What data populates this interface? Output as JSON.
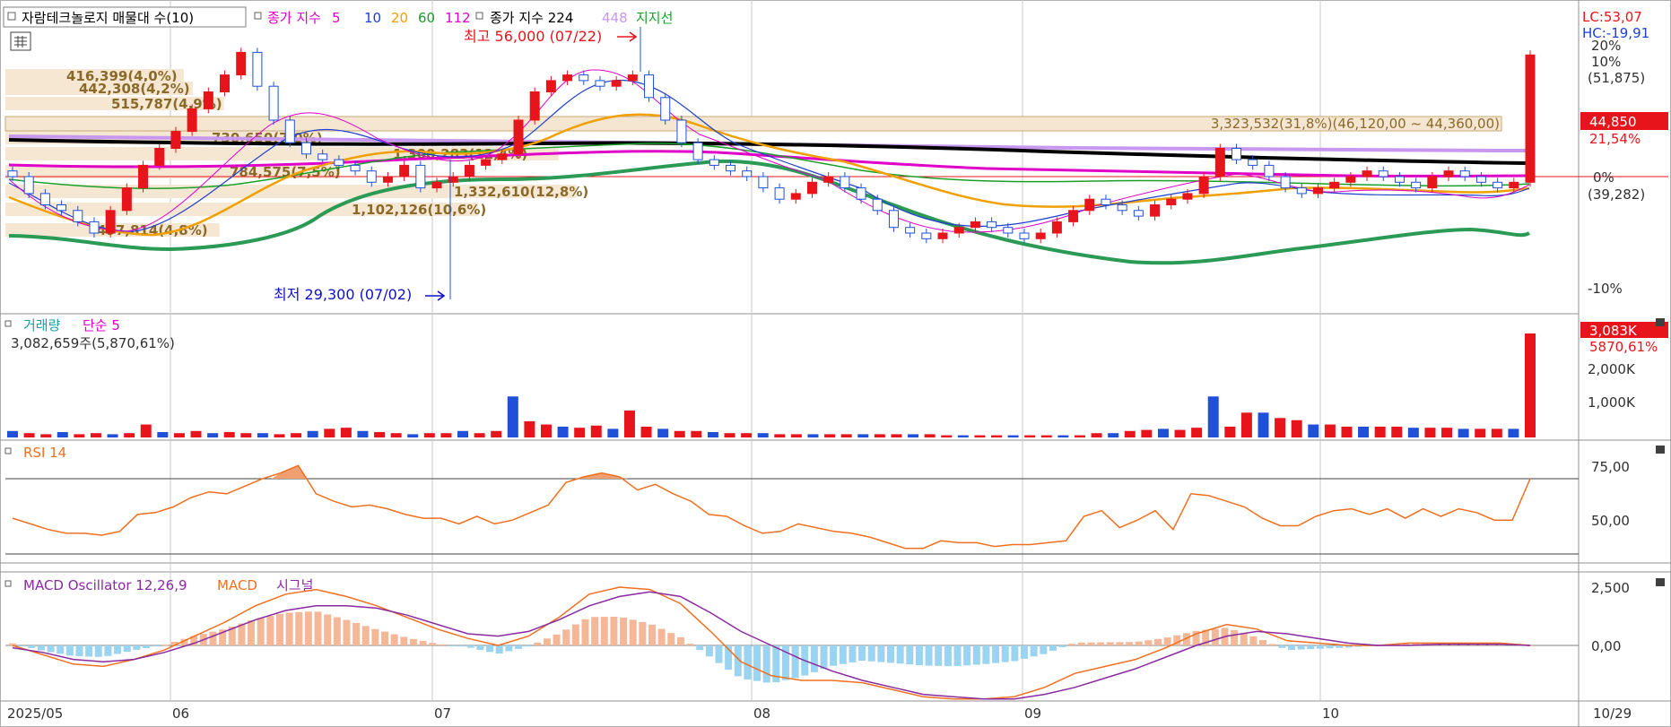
{
  "main_legend": {
    "title": "자람테크놀로지 매물대 수(10)",
    "ma_label": "종가 지수",
    "ma_periods": [
      "5",
      "10",
      "20",
      "60",
      "112"
    ],
    "ma_colors": [
      "#e000c8",
      "#1f3fd0",
      "#f0a000",
      "#1aa02a",
      "#e000c8"
    ],
    "long_label": "종가 지수 224",
    "long_2": "448",
    "support": "지지선"
  },
  "indicators": {
    "lc": "LC:53,07",
    "hc": "HC:-19,91",
    "high": "최고 56,000 (07/22)",
    "low": "최저 29,300 (07/02)",
    "range_label": "3,323,532(31,8%)(46,120,00 ~ 44,360,00)"
  },
  "right_axis": {
    "p20": "20%",
    "p10": "10%",
    "price_hi": "(51,875)",
    "price_tag": "44,850",
    "pct_tag": "21,54%",
    "zero": "0%",
    "price_lo": "(39,282)",
    "m10": "-10%"
  },
  "volume_profile": [
    {
      "label": "416,399(4,0%)",
      "value": 416399,
      "pct": 4.0
    },
    {
      "label": "442,308(4,2%)",
      "value": 442308,
      "pct": 4.2
    },
    {
      "label": "515,787(4,9%)",
      "value": 515787,
      "pct": 4.9
    },
    {
      "label": "730,650(7,0%)",
      "value": 730650,
      "pct": 7.0
    },
    {
      "label": "1,300,283(12,4%)",
      "value": 1300283,
      "pct": 12.4
    },
    {
      "label": "784,575(7,5%)",
      "value": 784575,
      "pct": 7.5
    },
    {
      "label": "1,332,610(12,8%)",
      "value": 1332610,
      "pct": 12.8
    },
    {
      "label": "1,102,126(10,6%)",
      "value": 1102126,
      "pct": 10.6
    },
    {
      "label": "497,814(4,8%)",
      "value": 497814,
      "pct": 4.8
    },
    {
      "label": "3,323,532(31,8%)",
      "value": 3323532,
      "pct": 31.8
    }
  ],
  "volume_panel": {
    "title": "거래량",
    "ma": "단순 5",
    "value": "3,082,659주(5,870,61%)",
    "tag": "3,083K",
    "tag2": "5870,61%",
    "ticks": [
      "2,000K",
      "1,000K"
    ]
  },
  "rsi_panel": {
    "title": "RSI 14",
    "ticks": [
      "75,00",
      "50,00"
    ]
  },
  "macd_panel": {
    "title": "MACD Oscillator 12,26,9",
    "macd": "MACD",
    "signal": "시그널",
    "ticks": [
      "2,500",
      "0,00"
    ]
  },
  "x_axis": {
    "labels": [
      "2025/05",
      "06",
      "07",
      "08",
      "09",
      "10",
      "10/29"
    ]
  },
  "colors": {
    "up": "#e8141c",
    "down": "#2050d8",
    "bg": "#ffffff",
    "grid": "#c8c8c8"
  },
  "chart_data": [
    {
      "type": "line",
      "title": "자람테크놀로지",
      "x_range": [
        "2025/05",
        "10/29"
      ],
      "y_scale": "percent from reference",
      "high": {
        "value": 56000,
        "date": "07/22"
      },
      "low": {
        "value": 29300,
        "date": "07/02"
      },
      "last_price": 44850,
      "change_pct": 21.54,
      "series": [
        {
          "name": "종가 지수 224",
          "color": "#000000"
        },
        {
          "name": "448",
          "color": "#c898f0"
        },
        {
          "name": "지지선",
          "color": "#2a9a55"
        }
      ],
      "close_index_pct": [
        0,
        -3,
        -5,
        -6,
        -8,
        -10,
        -6,
        -2,
        2,
        5,
        8,
        12,
        15,
        18,
        22,
        16,
        10,
        6,
        4,
        3,
        2,
        1,
        -1,
        0,
        2,
        -2,
        -1,
        0,
        2,
        3,
        4,
        10,
        15,
        17,
        18,
        17,
        16,
        17,
        18,
        14,
        10,
        6,
        3,
        2,
        1,
        0,
        -2,
        -4,
        -3,
        -1,
        0,
        -2,
        -4,
        -6,
        -9,
        -10,
        -11,
        -10,
        -9,
        -8,
        -9,
        -10,
        -11,
        -10,
        -8,
        -6,
        -4,
        -5,
        -6,
        -7,
        -5,
        -4,
        -3,
        0,
        5,
        3,
        2,
        0,
        -2,
        -3,
        -2,
        -1,
        0,
        1,
        0,
        -1,
        -2,
        0,
        1,
        0,
        -1,
        -2,
        -1,
        21.54
      ]
    },
    {
      "type": "bar",
      "title": "거래량",
      "last_value": 3082659,
      "values_k": [
        60,
        40,
        30,
        50,
        30,
        40,
        30,
        40,
        120,
        50,
        40,
        60,
        40,
        50,
        40,
        40,
        30,
        40,
        60,
        80,
        90,
        60,
        50,
        40,
        30,
        40,
        40,
        60,
        40,
        60,
        380,
        150,
        120,
        100,
        90,
        110,
        80,
        250,
        100,
        80,
        60,
        60,
        50,
        40,
        40,
        40,
        30,
        30,
        30,
        30,
        30,
        30,
        30,
        30,
        30,
        30,
        20,
        20,
        20,
        20,
        20,
        20,
        20,
        20,
        20,
        40,
        40,
        60,
        70,
        80,
        70,
        90,
        380,
        100,
        230,
        230,
        180,
        160,
        120,
        120,
        100,
        100,
        100,
        100,
        90,
        90,
        90,
        80,
        80,
        80,
        80,
        3083
      ]
    },
    {
      "type": "line",
      "title": "RSI 14",
      "ylim": [
        30,
        80
      ],
      "values": [
        49,
        46,
        43,
        41,
        41,
        40,
        42,
        51,
        52,
        55,
        60,
        63,
        62,
        66,
        70,
        73,
        77,
        62,
        58,
        55,
        56,
        54,
        51,
        49,
        49,
        46,
        50,
        46,
        48,
        52,
        56,
        68,
        71,
        73,
        71,
        64,
        67,
        62,
        58,
        51,
        50,
        45,
        41,
        42,
        46,
        44,
        42,
        41,
        39,
        36,
        33,
        33,
        37,
        36,
        36,
        34,
        35,
        35,
        36,
        37,
        50,
        53,
        44,
        48,
        53,
        43,
        62,
        61,
        58,
        55,
        49,
        45,
        45,
        50,
        53,
        54,
        51,
        54,
        49,
        54,
        50,
        54,
        52,
        48,
        48,
        70
      ]
    },
    {
      "type": "line",
      "title": "MACD Oscillator 12,26,9",
      "ylim": [
        -2500,
        2500
      ],
      "series": [
        {
          "name": "MACD",
          "values": [
            0,
            -400,
            -800,
            -900,
            -600,
            -200,
            400,
            1000,
            1700,
            2200,
            2400,
            2100,
            1700,
            1200,
            700,
            300,
            0,
            400,
            1200,
            2200,
            2500,
            2400,
            1800,
            600,
            -700,
            -1300,
            -1500,
            -1500,
            -1600,
            -1900,
            -2200,
            -2300,
            -2300,
            -2200,
            -1800,
            -1200,
            -900,
            -600,
            -100,
            500,
            900,
            700,
            200,
            100,
            0,
            0,
            100,
            100,
            100,
            100,
            0
          ]
        },
        {
          "name": "시그널",
          "values": [
            -100,
            -300,
            -600,
            -700,
            -600,
            -300,
            100,
            600,
            1100,
            1500,
            1700,
            1700,
            1600,
            1300,
            900,
            500,
            400,
            600,
            1100,
            1700,
            2100,
            2300,
            2100,
            1400,
            600,
            0,
            -600,
            -1100,
            -1500,
            -1800,
            -2100,
            -2200,
            -2300,
            -2300,
            -2100,
            -1800,
            -1400,
            -1000,
            -500,
            0,
            400,
            600,
            500,
            300,
            100,
            0,
            0,
            50,
            50,
            50,
            0
          ]
        }
      ]
    }
  ]
}
